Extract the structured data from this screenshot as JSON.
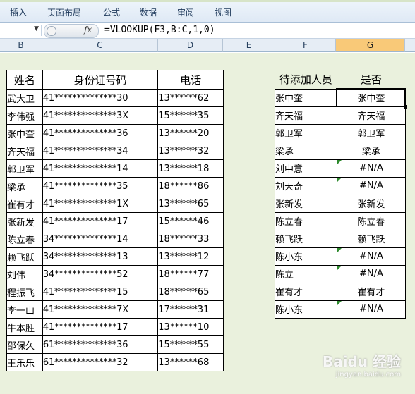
{
  "ribbon": {
    "tabs": [
      "插入",
      "页面布局",
      "公式",
      "数据",
      "审阅",
      "视图"
    ]
  },
  "formula_bar": {
    "name_box": "",
    "fx_label": "fx",
    "formula": "=VLOOKUP(F3,B:C,1,0)"
  },
  "columns": [
    "B",
    "C",
    "D",
    "E",
    "F",
    "G"
  ],
  "left_table": {
    "headers": [
      "姓名",
      "身份证号码",
      "电话"
    ],
    "rows": [
      [
        "武大卫",
        "41**************30",
        "13******62"
      ],
      [
        "李伟强",
        "41**************3X",
        "15******35"
      ],
      [
        "张中奎",
        "41**************36",
        "13******20"
      ],
      [
        "齐天福",
        "41**************34",
        "13******32"
      ],
      [
        "郭卫军",
        "41**************14",
        "13******18"
      ],
      [
        "梁承",
        "41**************35",
        "18******86"
      ],
      [
        "崔有才",
        "41**************1X",
        "13******65"
      ],
      [
        "张新发",
        "41**************17",
        "15******46"
      ],
      [
        "陈立春",
        "34**************14",
        "18******33"
      ],
      [
        "赖飞跃",
        "34**************13",
        "13******12"
      ],
      [
        "刘伟",
        "34**************52",
        "18******77"
      ],
      [
        "程振飞",
        "41**************15",
        "18******65"
      ],
      [
        "李一山",
        "41**************7X",
        "17******31"
      ],
      [
        "牛本胜",
        "41**************17",
        "13******10"
      ],
      [
        "邵保久",
        "61**************36",
        "15******55"
      ],
      [
        "王乐乐",
        "61**************32",
        "13******68"
      ]
    ]
  },
  "right_table": {
    "headers": [
      "待添加人员",
      "是否"
    ],
    "rows": [
      [
        "张中奎",
        "张中奎"
      ],
      [
        "齐天福",
        "齐天福"
      ],
      [
        "郭卫军",
        "郭卫军"
      ],
      [
        "梁承",
        "梁承"
      ],
      [
        "刘中意",
        "#N/A"
      ],
      [
        "刘天奇",
        "#N/A"
      ],
      [
        "张新发",
        "张新发"
      ],
      [
        "陈立春",
        "陈立春"
      ],
      [
        "赖飞跃",
        "赖飞跃"
      ],
      [
        "陈小东",
        "#N/A"
      ],
      [
        "陈立",
        "#N/A"
      ],
      [
        "崔有才",
        "崔有才"
      ],
      [
        "陈小东",
        "#N/A"
      ]
    ]
  },
  "watermark": {
    "text": "Baidu 经验",
    "sub": "jingyan.baidu.com"
  }
}
